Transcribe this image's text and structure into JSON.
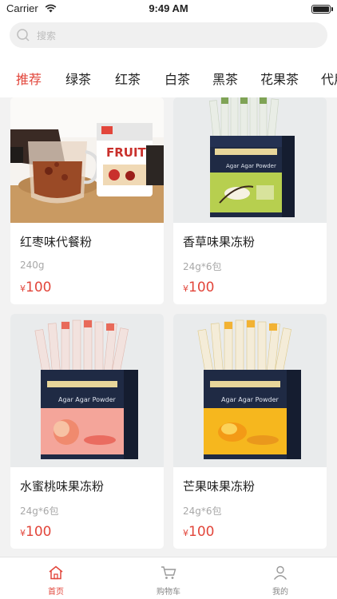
{
  "status_bar": {
    "carrier": "Carrier",
    "time": "9:49 AM"
  },
  "search": {
    "placeholder": "搜索"
  },
  "tabs": [
    {
      "label": "推荐",
      "active": true
    },
    {
      "label": "绿茶",
      "active": false
    },
    {
      "label": "红茶",
      "active": false
    },
    {
      "label": "白茶",
      "active": false
    },
    {
      "label": "黑茶",
      "active": false
    },
    {
      "label": "花果茶",
      "active": false
    },
    {
      "label": "代用",
      "active": false
    }
  ],
  "products": [
    {
      "name": "红枣味代餐粉",
      "spec": "240g",
      "currency": "¥",
      "price": "100",
      "image_text": "FRUIT"
    },
    {
      "name": "香草味果冻粉",
      "spec": "24g*6包",
      "currency": "¥",
      "price": "100",
      "image_text": "Agar Agar Powder"
    },
    {
      "name": "水蜜桃味果冻粉",
      "spec": "24g*6包",
      "currency": "¥",
      "price": "100",
      "image_text": "Agar Agar Powder"
    },
    {
      "name": "芒果味果冻粉",
      "spec": "24g*6包",
      "currency": "¥",
      "price": "100",
      "image_text": "Agar Agar Powder"
    }
  ],
  "tabbar": [
    {
      "label": "首页",
      "icon": "home-icon",
      "active": true
    },
    {
      "label": "购物车",
      "icon": "cart-icon",
      "active": false
    },
    {
      "label": "我的",
      "icon": "user-icon",
      "active": false
    }
  ],
  "colors": {
    "accent": "#e2463b",
    "background": "#f2f2f2"
  }
}
